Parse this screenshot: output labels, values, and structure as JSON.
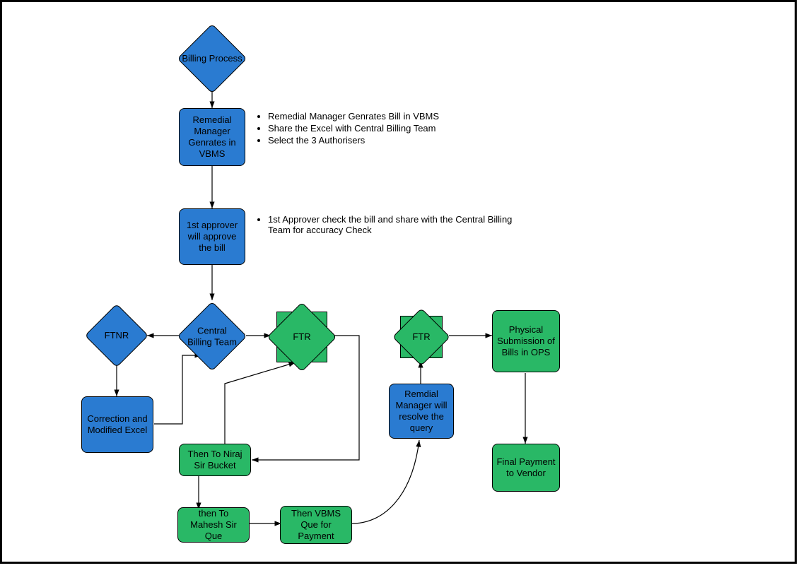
{
  "nodes": {
    "start": "Billing Process",
    "n1": "Remedial Manager Genrates in VBMS",
    "n2": "1st approver will approve the bill",
    "ftnr": "FTNR",
    "cbt": "Central Billing Team",
    "ftr1": "FTR",
    "n3": "Correction and Modified Excel",
    "n4": "Then To Niraj Sir Bucket",
    "n5": "then To Mahesh Sir Que",
    "n6": "Then VBMS Que for Payment",
    "n7": "Remdial Manager will resolve the query",
    "ftr2": "FTR",
    "n8": "Physical Submission of Bills in OPS",
    "n9": "Final Payment to Vendor"
  },
  "annotations": {
    "a1_1": "Remedial Manager Genrates Bill in VBMS",
    "a1_2": "Share the Excel with Central Billing Team",
    "a1_3": "Select the 3 Authorisers",
    "a2_1": "1st Approver check the bill and share with the Central Billing Team for accuracy Check"
  }
}
